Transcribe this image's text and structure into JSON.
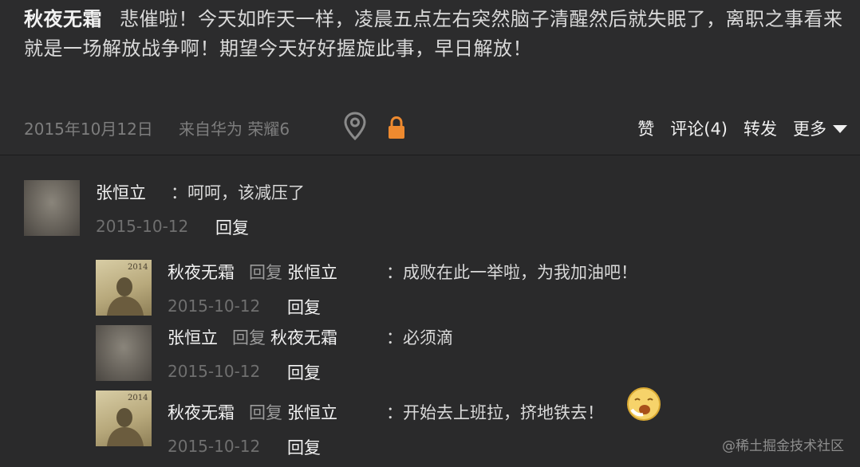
{
  "post": {
    "author": "秋夜无霜",
    "text": "悲催啦！今天如昨天一样，凌晨五点左右突然脑子清醒然后就失眠了，离职之事看来就是一场解放战争啊！期望今天好好握旋此事，早日解放！",
    "date": "2015年10月12日",
    "source": "来自华为 荣耀6",
    "location_icon": "location-pin-icon",
    "lock_icon": "lock-icon",
    "lock_color": "#ee8a2f",
    "actions": {
      "like": "赞",
      "comment": "评论(4)",
      "repost": "转发",
      "more": "更多"
    }
  },
  "comments": [
    {
      "author": "张恒立",
      "text": "：呵呵，该减压了",
      "date": "2015-10-12",
      "reply_label": "回复"
    }
  ],
  "replies": [
    {
      "author": "秋夜无霜",
      "reply_word": "回复",
      "target": "张恒立",
      "text": "：成败在此一举啦，为我加油吧！",
      "date": "2015-10-12",
      "reply_label": "回复",
      "avatar_text": "2014"
    },
    {
      "author": "张恒立",
      "reply_word": "回复",
      "target": "秋夜无霜",
      "text": "：必须滴",
      "date": "2015-10-12",
      "reply_label": "回复"
    },
    {
      "author": "秋夜无霜",
      "reply_word": "回复",
      "target": "张恒立",
      "text": "：开始去上班拉，挤地铁去！",
      "date": "2015-10-12",
      "reply_label": "回复",
      "emoji": "yawn-emoji-icon",
      "avatar_text": "2014"
    }
  ],
  "watermark": "@稀土掘金技术社区",
  "colors": {
    "background": "#2a2a2b",
    "accent": "#ee8a2f"
  }
}
